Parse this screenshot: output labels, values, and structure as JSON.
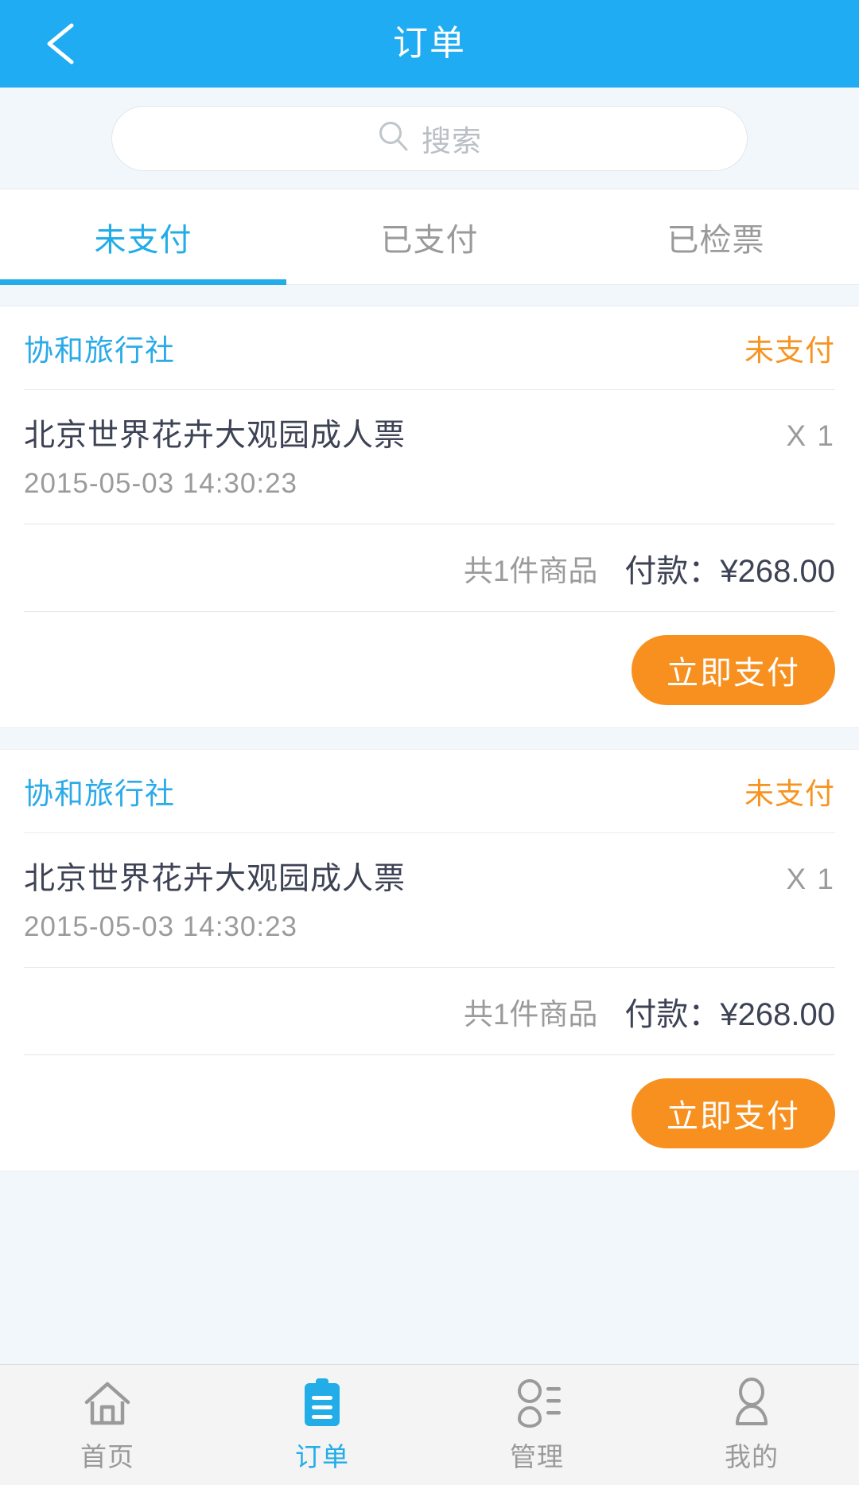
{
  "header": {
    "title": "订单",
    "back_icon": "arrow-left-icon",
    "background_color": "#20acf2"
  },
  "search": {
    "placeholder": "搜索",
    "value": "",
    "icon": "search-icon"
  },
  "tabs": [
    {
      "label": "未支付",
      "active": true
    },
    {
      "label": "已支付",
      "active": false
    },
    {
      "label": "已检票",
      "active": false
    }
  ],
  "colors": {
    "accent_blue": "#22ade8",
    "status_orange": "#f79420",
    "button_orange": "#f7901e",
    "text_dark": "#3d4355",
    "text_muted": "#9b9b9b"
  },
  "orders": [
    {
      "vendor": "协和旅行社",
      "status": "未支付",
      "item_name": "北京世界花卉大观园成人票",
      "item_qty": "X 1",
      "item_time": "2015-05-03   14:30:23",
      "total_count": "共1件商品",
      "total_amount": "付款：¥268.00",
      "action_label": "立即支付"
    },
    {
      "vendor": "协和旅行社",
      "status": "未支付",
      "item_name": "北京世界花卉大观园成人票",
      "item_qty": "X 1",
      "item_time": "2015-05-03   14:30:23",
      "total_count": "共1件商品",
      "total_amount": "付款：¥268.00",
      "action_label": "立即支付"
    }
  ],
  "tabbar": [
    {
      "label": "首页",
      "icon": "home-icon",
      "active": false
    },
    {
      "label": "订单",
      "icon": "clipboard-icon",
      "active": true
    },
    {
      "label": "管理",
      "icon": "users-list-icon",
      "active": false
    },
    {
      "label": "我的",
      "icon": "person-icon",
      "active": false
    }
  ]
}
